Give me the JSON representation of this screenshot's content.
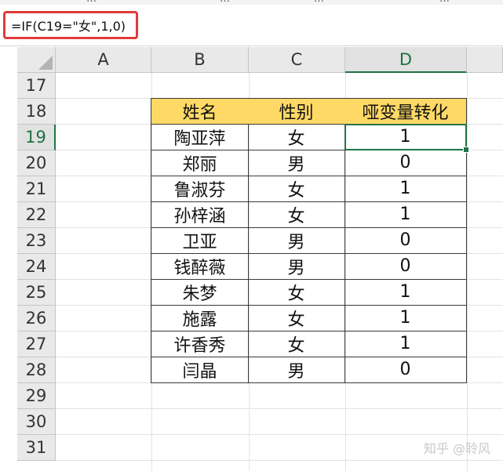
{
  "formula_bar": {
    "formula": "=IF(C19=\"女\",1,0)"
  },
  "columns": [
    "A",
    "B",
    "C",
    "D"
  ],
  "active_column": "D",
  "rows": [
    "17",
    "18",
    "19",
    "20",
    "21",
    "22",
    "23",
    "24",
    "25",
    "26",
    "27",
    "28",
    "29",
    "30",
    "31"
  ],
  "active_row": "19",
  "table": {
    "headers": [
      "姓名",
      "性别",
      "哑变量转化"
    ],
    "records": [
      [
        "陶亚萍",
        "女",
        "1"
      ],
      [
        "郑丽",
        "男",
        "0"
      ],
      [
        "鲁淑芬",
        "女",
        "1"
      ],
      [
        "孙梓涵",
        "女",
        "1"
      ],
      [
        "卫亚",
        "男",
        "0"
      ],
      [
        "钱醉薇",
        "男",
        "0"
      ],
      [
        "朱梦",
        "女",
        "1"
      ],
      [
        "施露",
        "女",
        "1"
      ],
      [
        "许香秀",
        "女",
        "1"
      ],
      [
        "闫晶",
        "男",
        "0"
      ]
    ]
  },
  "watermark": "知乎 @聆风",
  "colors": {
    "header_fill": "#ffd966",
    "selection": "#217346",
    "formula_highlight": "#e23b3b"
  }
}
